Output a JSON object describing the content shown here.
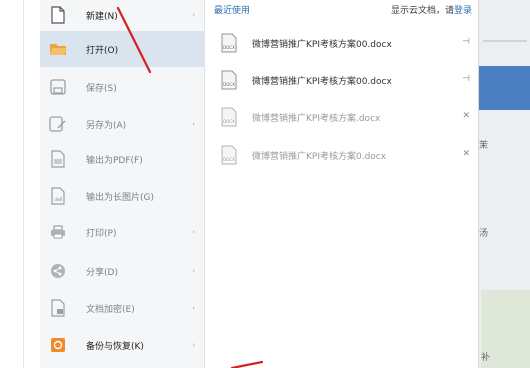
{
  "menu": {
    "items": [
      {
        "label": "新建(N)",
        "has_arrow": true
      },
      {
        "label": "打开(O)",
        "has_arrow": false
      },
      {
        "label": "保存(S)",
        "has_arrow": false
      },
      {
        "label": "另存为(A)",
        "has_arrow": true
      },
      {
        "label": "输出为PDF(F)",
        "has_arrow": false
      },
      {
        "label": "输出为长图片(G)",
        "has_arrow": false
      },
      {
        "label": "打印(P)",
        "has_arrow": true
      },
      {
        "label": "分享(D)",
        "has_arrow": true
      },
      {
        "label": "文档加密(E)",
        "has_arrow": true
      },
      {
        "label": "备份与恢复(K)",
        "has_arrow": true
      }
    ],
    "arrow_glyph": "›"
  },
  "recent": {
    "title": "最近使用",
    "cloud_hint_prefix": "显示云文档，请",
    "cloud_hint_login": "登录",
    "files": [
      {
        "name": "微博营销推广KPI考核方案00.docx",
        "action_icon": "pin-icon",
        "action_glyph": "⊣"
      },
      {
        "name": "微博营销推广KPI考核方案00.docx",
        "action_icon": "pin-icon",
        "action_glyph": "⊣"
      },
      {
        "name": "微博营销推广KPI考核方案.docx",
        "action_icon": "close-icon",
        "action_glyph": "✕"
      },
      {
        "name": "微博营销推广KPI考核方案0.docx",
        "action_icon": "close-icon",
        "action_glyph": "✕"
      }
    ],
    "doc_badge": "DOCX"
  },
  "strip": {
    "fragment_1": "茉",
    "fragment_2": "汤",
    "fragment_3": "补"
  },
  "colors": {
    "accent": "#2f6fb3",
    "open_icon": "#f0a33a",
    "backup_icon": "#f08a2b",
    "annotation_red": "#d61f1f"
  }
}
